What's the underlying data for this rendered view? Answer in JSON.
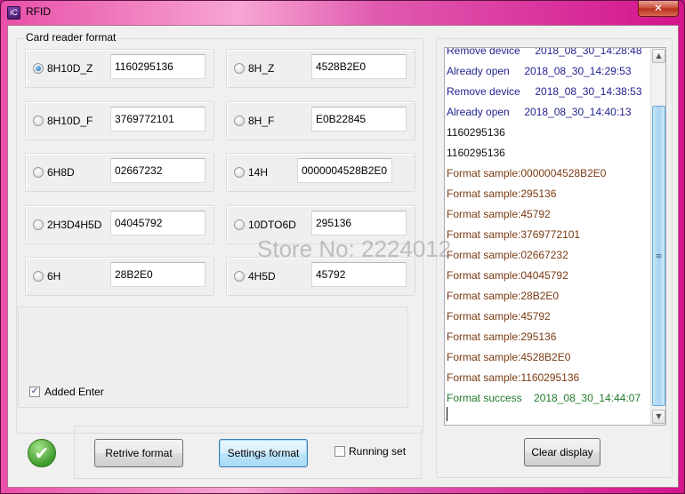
{
  "window": {
    "title": "RFID",
    "app_icon_glyph": "iC",
    "close_glyph": "✕"
  },
  "format_group": {
    "legend": "Card reader format",
    "options": [
      {
        "label": "8H10D_Z",
        "value": "1160295136",
        "checked": true
      },
      {
        "label": "8H_Z",
        "value": "4528B2E0",
        "checked": false
      },
      {
        "label": "8H10D_F",
        "value": "3769772101",
        "checked": false
      },
      {
        "label": "8H_F",
        "value": "E0B22845",
        "checked": false
      },
      {
        "label": "6H8D",
        "value": "02667232",
        "checked": false
      },
      {
        "label": "14H",
        "value": "0000004528B2E0",
        "checked": false
      },
      {
        "label": "2H3D4H5D",
        "value": "04045792",
        "checked": false
      },
      {
        "label": "10DTO6D",
        "value": "295136",
        "checked": false
      },
      {
        "label": "6H",
        "value": "28B2E0",
        "checked": false
      },
      {
        "label": "4H5D",
        "value": "45792",
        "checked": false
      }
    ],
    "added_enter": {
      "label": "Added Enter",
      "checked": true
    }
  },
  "status_icon": "check-circle",
  "status_glyph": "✔",
  "buttons": {
    "retrive": "Retrive format",
    "settings": "Settings format",
    "running_set": {
      "label": "Running set",
      "checked": false
    },
    "clear": "Clear display"
  },
  "log": {
    "lines": [
      {
        "text": "Remove device     2018_08_30_14:28:48",
        "kind": "info"
      },
      {
        "text": "Already open     2018_08_30_14:29:53",
        "kind": "info"
      },
      {
        "text": "Remove device     2018_08_30_14:38:53",
        "kind": "info"
      },
      {
        "text": "Already open     2018_08_30_14:40:13",
        "kind": "info"
      },
      {
        "text": "1160295136",
        "kind": "plain"
      },
      {
        "text": "1160295136",
        "kind": "plain"
      },
      {
        "text": "Format sample:0000004528B2E0",
        "kind": "sample"
      },
      {
        "text": "Format sample:295136",
        "kind": "sample"
      },
      {
        "text": "Format sample:45792",
        "kind": "sample"
      },
      {
        "text": "Format sample:3769772101",
        "kind": "sample"
      },
      {
        "text": "Format sample:02667232",
        "kind": "sample"
      },
      {
        "text": "Format sample:04045792",
        "kind": "sample"
      },
      {
        "text": "Format sample:28B2E0",
        "kind": "sample"
      },
      {
        "text": "Format sample:45792",
        "kind": "sample"
      },
      {
        "text": "Format sample:295136",
        "kind": "sample"
      },
      {
        "text": "Format sample:4528B2E0",
        "kind": "sample"
      },
      {
        "text": "Format sample:1160295136",
        "kind": "sample"
      },
      {
        "text": "Format success    2018_08_30_14:44:07",
        "kind": "success"
      }
    ],
    "scroll_position_fraction": 1.0
  },
  "watermark": "Store No: 2224012",
  "colors": {
    "info": "#1f1f8f",
    "sample": "#7a3a12",
    "success": "#1f7a2a",
    "title_bar": "#d4148c"
  }
}
